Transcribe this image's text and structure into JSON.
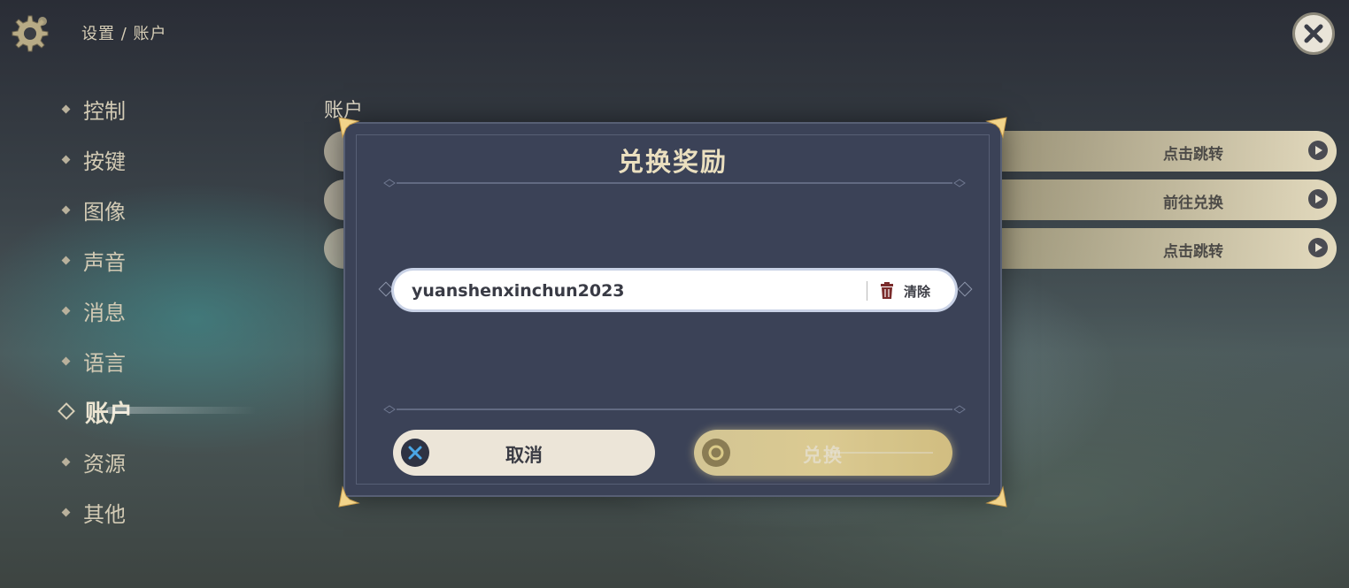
{
  "header": {
    "breadcrumb": "设置 / 账户",
    "settings_icon": "gear-icon",
    "close_icon": "close-icon"
  },
  "sidebar": {
    "items": [
      {
        "label": "控制",
        "active": false
      },
      {
        "label": "按键",
        "active": false
      },
      {
        "label": "图像",
        "active": false
      },
      {
        "label": "声音",
        "active": false
      },
      {
        "label": "消息",
        "active": false
      },
      {
        "label": "语言",
        "active": false
      },
      {
        "label": "账户",
        "active": true
      },
      {
        "label": "资源",
        "active": false
      },
      {
        "label": "其他",
        "active": false
      }
    ]
  },
  "account": {
    "title": "账户",
    "rows": [
      {
        "action_label": "点击跳转"
      },
      {
        "action_label": "前往兑换"
      },
      {
        "action_label": "点击跳转"
      }
    ]
  },
  "dialog": {
    "title": "兑换奖励",
    "code_value": "yuanshenxinchun2023",
    "clear_label": "清除",
    "cancel_label": "取消",
    "confirm_label": "兑换"
  },
  "colors": {
    "dialog_bg": "#3b4257",
    "title_gold": "#eadfbf",
    "confirm_gold": "#f1dd9a",
    "cancel_bg": "#ece5d8"
  }
}
